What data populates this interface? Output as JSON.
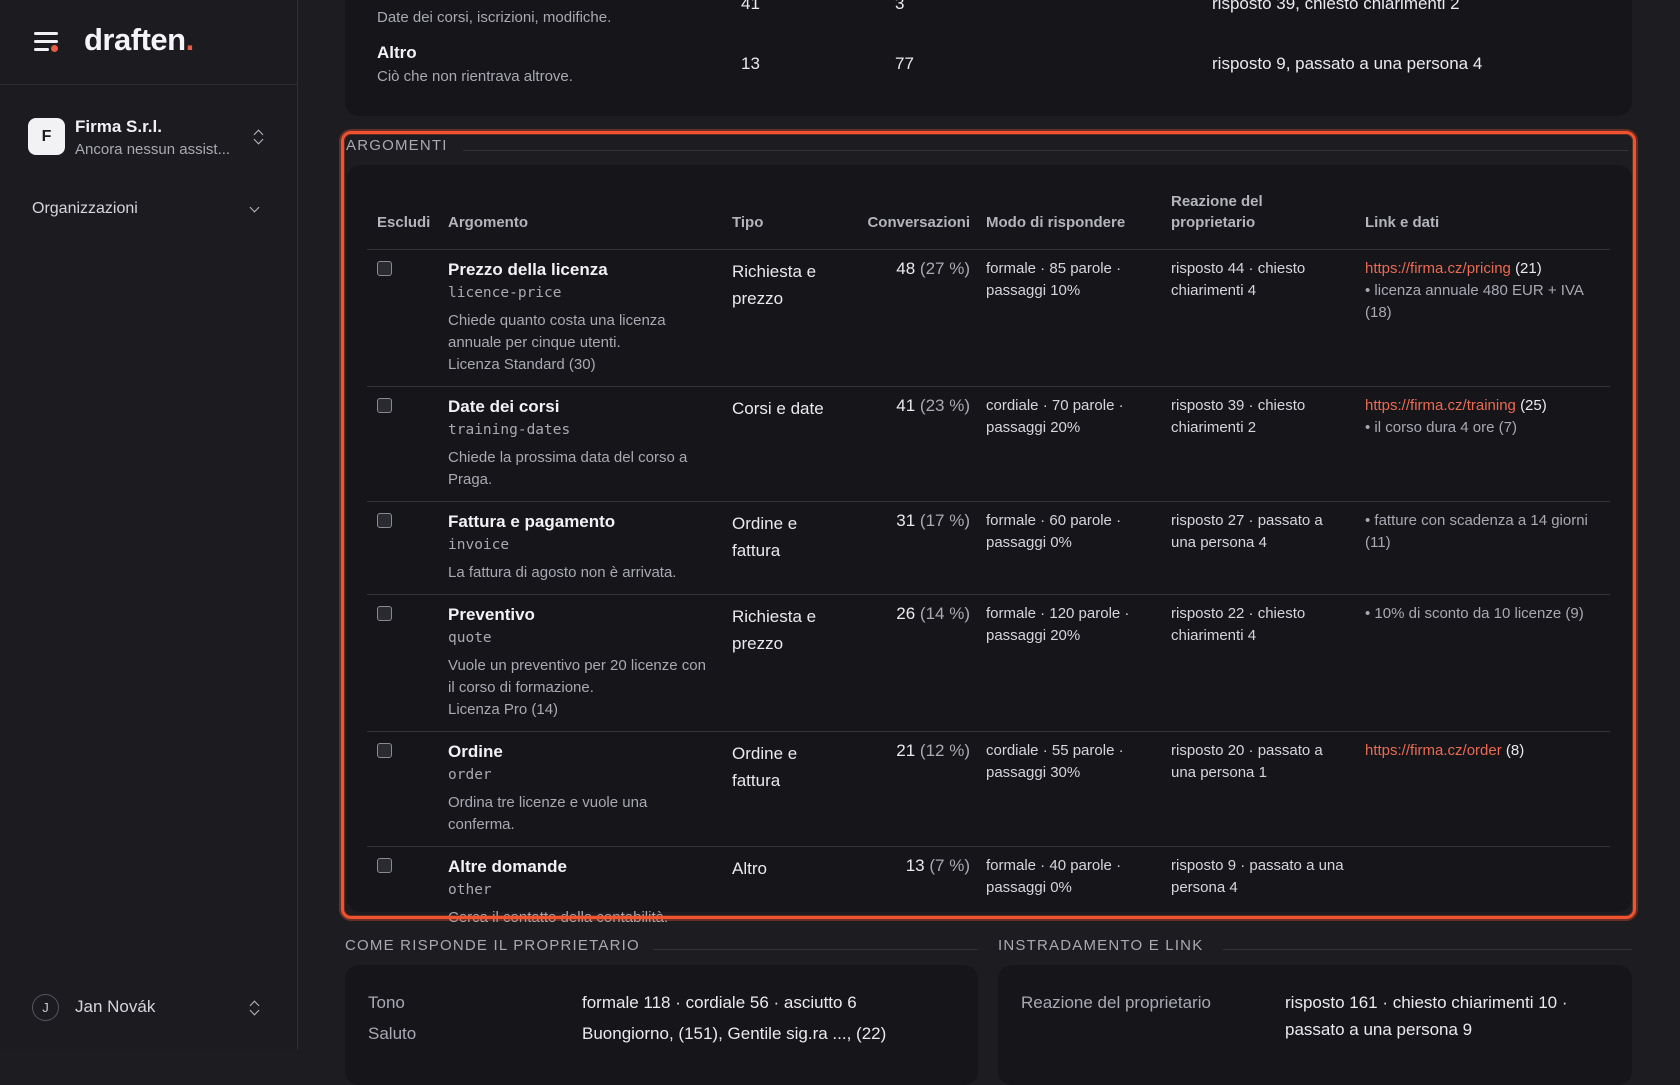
{
  "sidebar": {
    "brand": "draften",
    "brand_dot": ".",
    "org": {
      "initial": "F",
      "name": "Firma S.r.l.",
      "subtitle": "Ancora nessun assist..."
    },
    "nav_item": "Organizzazioni",
    "user": {
      "initial": "J",
      "name": "Jan Novák"
    }
  },
  "summary_rows": [
    {
      "title": "",
      "desc": "Date dei corsi, iscrizioni, modifiche.",
      "n1": "41",
      "n2": "3",
      "reaction": "risposto 39, chiesto chiarimenti 2"
    },
    {
      "title": "Altro",
      "desc": "Ciò che non rientrava altrove.",
      "n1": "13",
      "n2": "77",
      "reaction": "risposto 9, passato a una persona 4"
    }
  ],
  "topics": {
    "title": "ARGOMENTI",
    "headers": {
      "exclude": "Escludi",
      "topic": "Argomento",
      "type": "Tipo",
      "conversations": "Conversazioni",
      "style": "Modo di rispondere",
      "reaction": "Reazione del proprietario",
      "links": "Link e dati"
    },
    "rows": [
      {
        "name": "Prezzo della licenza",
        "code": "licence-price",
        "desc": "Chiede quanto costa una licenza annuale per cinque utenti.",
        "license": "Licenza Standard (30)",
        "type": "Richiesta e prezzo",
        "count": "48",
        "pct": "(27 %)",
        "style": "formale · 85 parole · passaggi 10%",
        "reaction": "risposto 44 · chiesto chiarimenti 4",
        "link": "https://firma.cz/pricing",
        "link_count": "(21)",
        "fact": "• licenza annuale 480 EUR + IVA (18)"
      },
      {
        "name": "Date dei corsi",
        "code": "training-dates",
        "desc": "Chiede la prossima data del corso a Praga.",
        "license": "",
        "type": "Corsi e date",
        "count": "41",
        "pct": "(23 %)",
        "style": "cordiale · 70 parole · passaggi 20%",
        "reaction": "risposto 39 · chiesto chiarimenti 2",
        "link": "https://firma.cz/training",
        "link_count": "(25)",
        "fact": "• il corso dura 4 ore (7)"
      },
      {
        "name": "Fattura e pagamento",
        "code": "invoice",
        "desc": "La fattura di agosto non è arrivata.",
        "license": "",
        "type": "Ordine e fattura",
        "count": "31",
        "pct": "(17 %)",
        "style": "formale · 60 parole · passaggi 0%",
        "reaction": "risposto 27 · passato a una persona 4",
        "link": "",
        "link_count": "",
        "fact": "• fatture con scadenza a 14 giorni (11)"
      },
      {
        "name": "Preventivo",
        "code": "quote",
        "desc": "Vuole un preventivo per 20 licenze con il corso di formazione.",
        "license": "Licenza Pro (14)",
        "type": "Richiesta e prezzo",
        "count": "26",
        "pct": "(14 %)",
        "style": "formale · 120 parole · passaggi 20%",
        "reaction": "risposto 22 · chiesto chiarimenti 4",
        "link": "",
        "link_count": "",
        "fact": "• 10% di sconto da 10 licenze (9)"
      },
      {
        "name": "Ordine",
        "code": "order",
        "desc": "Ordina tre licenze e vuole una conferma.",
        "license": "",
        "type": "Ordine e fattura",
        "count": "21",
        "pct": "(12 %)",
        "style": "cordiale · 55 parole · passaggi 30%",
        "reaction": "risposto 20 · passato a una persona 1",
        "link": "https://firma.cz/order",
        "link_count": "(8)",
        "fact": ""
      },
      {
        "name": "Altre domande",
        "code": "other",
        "desc": "Cerca il contatto della contabilità.",
        "license": "",
        "type": "Altro",
        "count": "13",
        "pct": "(7 %)",
        "style": "formale · 40 parole · passaggi 0%",
        "reaction": "risposto 9 · passato a una persona 4",
        "link": "",
        "link_count": "",
        "fact": ""
      }
    ]
  },
  "owner_section": {
    "title": "COME RISPONDE IL PROPRIETARIO",
    "rows": [
      {
        "k": "Tono",
        "v": "formale 118 · cordiale 56 · asciutto 6"
      },
      {
        "k": "Saluto",
        "v": "Buongiorno, (151), Gentile sig.ra ..., (22)"
      }
    ]
  },
  "routing_section": {
    "title": "INSTRADAMENTO E LINK",
    "row": {
      "k": "Reazione del proprietario",
      "v1": "risposto 161 · chiesto chiarimenti 10 ·",
      "v2": "passato a una persona 9"
    }
  }
}
